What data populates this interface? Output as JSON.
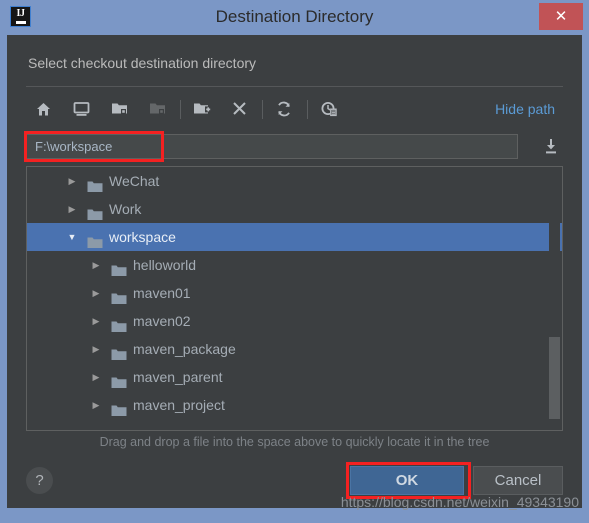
{
  "window": {
    "title": "Destination Directory",
    "app_icon": "intellij-idea-icon",
    "close_label": "✕",
    "titlebar_color": "#7b97c6",
    "close_color": "#c15356"
  },
  "dialog": {
    "subtitle": "Select checkout destination directory",
    "hint": "Drag and drop a file into the space above to quickly locate it in the tree"
  },
  "toolbar": {
    "hide_path_label": "Hide path",
    "link_color": "#5b9bd5",
    "items": [
      {
        "name": "home-icon",
        "title": "Home",
        "enabled": true
      },
      {
        "name": "desktop-icon",
        "title": "Desktop",
        "enabled": true
      },
      {
        "name": "project-folder-icon",
        "title": "Project Directory",
        "enabled": true
      },
      {
        "name": "module-folder-icon",
        "title": "Module Directory",
        "enabled": false
      },
      {
        "name": "new-folder-icon",
        "title": "New Folder",
        "enabled": true
      },
      {
        "name": "delete-icon",
        "title": "Delete",
        "enabled": true
      },
      {
        "name": "refresh-icon",
        "title": "Refresh",
        "enabled": true
      },
      {
        "name": "show-hidden-icon",
        "title": "Show Hidden Files",
        "enabled": true
      }
    ]
  },
  "path": {
    "value": "F:\\workspace",
    "placeholder": "",
    "highlight_color": "#f42121",
    "import_icon": "import-icon"
  },
  "tree": {
    "rows": [
      {
        "label": "WeChat",
        "depth": 1,
        "expanded": false,
        "selected": false,
        "twisty": "▶"
      },
      {
        "label": "Work",
        "depth": 1,
        "expanded": false,
        "selected": false,
        "twisty": "▶"
      },
      {
        "label": "workspace",
        "depth": 1,
        "expanded": true,
        "selected": true,
        "twisty": "▼"
      },
      {
        "label": "helloworld",
        "depth": 2,
        "expanded": false,
        "selected": false,
        "twisty": "▶"
      },
      {
        "label": "maven01",
        "depth": 2,
        "expanded": false,
        "selected": false,
        "twisty": "▶"
      },
      {
        "label": "maven02",
        "depth": 2,
        "expanded": false,
        "selected": false,
        "twisty": "▶"
      },
      {
        "label": "maven_package",
        "depth": 2,
        "expanded": false,
        "selected": false,
        "twisty": "▶"
      },
      {
        "label": "maven_parent",
        "depth": 2,
        "expanded": false,
        "selected": false,
        "twisty": "▶"
      },
      {
        "label": "maven_project",
        "depth": 2,
        "expanded": false,
        "selected": false,
        "twisty": "▶"
      }
    ],
    "selection_color": "#4a72b0"
  },
  "footer": {
    "help_label": "?",
    "ok_label": "OK",
    "cancel_label": "Cancel",
    "ok_highlight_color": "#f42121"
  },
  "watermark": {
    "text": "https://blog.csdn.net/weixin_49343190"
  }
}
